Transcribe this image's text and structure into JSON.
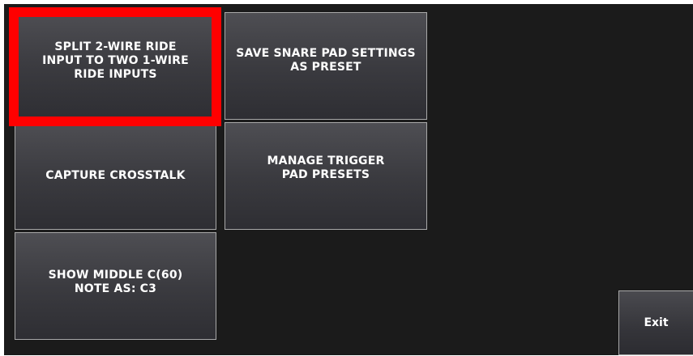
{
  "buttons": {
    "split_ride": "SPLIT 2-WIRE RIDE\nINPUT TO TWO 1-WIRE\nRIDE INPUTS",
    "save_snare": "SAVE SNARE PAD SETTINGS\nAS PRESET",
    "capture_crosstalk": "CAPTURE CROSSTALK",
    "manage_presets": "MANAGE TRIGGER\nPAD PRESETS",
    "show_middle_c": "SHOW MIDDLE C(60)\nNOTE AS: C3",
    "exit": "Exit"
  },
  "colors": {
    "highlight": "#ff0000",
    "background": "#1b1b1b",
    "tile_border": "#a9a9a9"
  }
}
